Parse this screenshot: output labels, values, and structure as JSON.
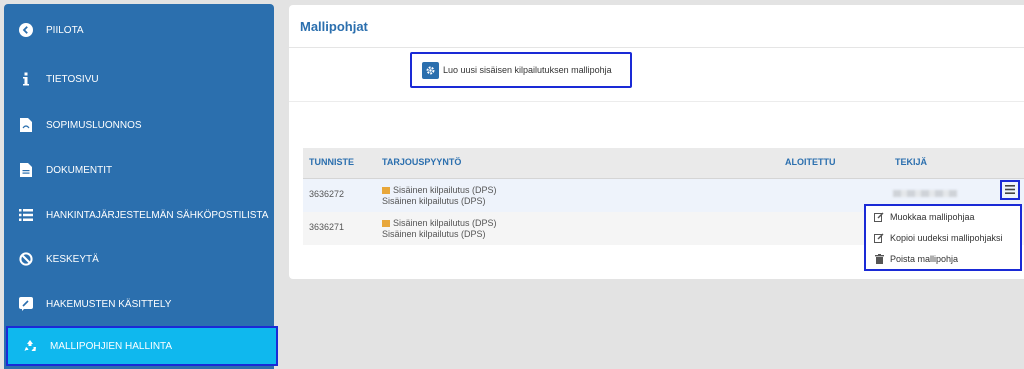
{
  "sidebar": {
    "items": [
      {
        "label": "PIILOTA",
        "icon": "chevron-left-circle-icon"
      },
      {
        "label": "TIETOSIVU",
        "icon": "info-icon"
      },
      {
        "label": "SOPIMUSLUONNOS",
        "icon": "pdf-file-icon"
      },
      {
        "label": "DOKUMENTIT",
        "icon": "document-icon"
      },
      {
        "label": "HANKINTAJÄRJESTELMÄN SÄHKÖPOSTILISTA",
        "icon": "list-icon"
      },
      {
        "label": "KESKEYTÄ",
        "icon": "ban-icon"
      },
      {
        "label": "HAKEMUSTEN KÄSITTELY",
        "icon": "edit-box-icon"
      },
      {
        "label": "MALLIPOHJIEN HALLINTA",
        "icon": "recycle-icon"
      }
    ],
    "active_index": 7,
    "colors": {
      "background": "#2b6fae",
      "active": "#0fb8ee",
      "highlight": "#1a2ad6"
    }
  },
  "panel": {
    "title": "Mallipohjat",
    "new_template_button": "Luo uusi sisäisen kilpailutuksen mallipohja"
  },
  "table": {
    "columns": [
      "TUNNISTE",
      "TARJOUSPYYNTÖ",
      "ALOITETTU",
      "TEKIJÄ"
    ],
    "rows": [
      {
        "id": "3636272",
        "offer_line1": "Sisäinen kilpailutus (DPS)",
        "offer_line2": "Sisäinen kilpailutus (DPS)",
        "started": "",
        "author": ""
      },
      {
        "id": "3636271",
        "offer_line1": "Sisäinen kilpailutus (DPS)",
        "offer_line2": "Sisäinen kilpailutus (DPS)",
        "started": "",
        "author": ""
      }
    ]
  },
  "row_menu": {
    "icon": "hamburger-icon",
    "items": [
      {
        "label": "Muokkaa mallipohjaa",
        "icon": "edit-icon"
      },
      {
        "label": "Kopioi uudeksi mallipohjaksi",
        "icon": "copy-edit-icon"
      },
      {
        "label": "Poista mallipohja",
        "icon": "trash-icon"
      }
    ]
  }
}
